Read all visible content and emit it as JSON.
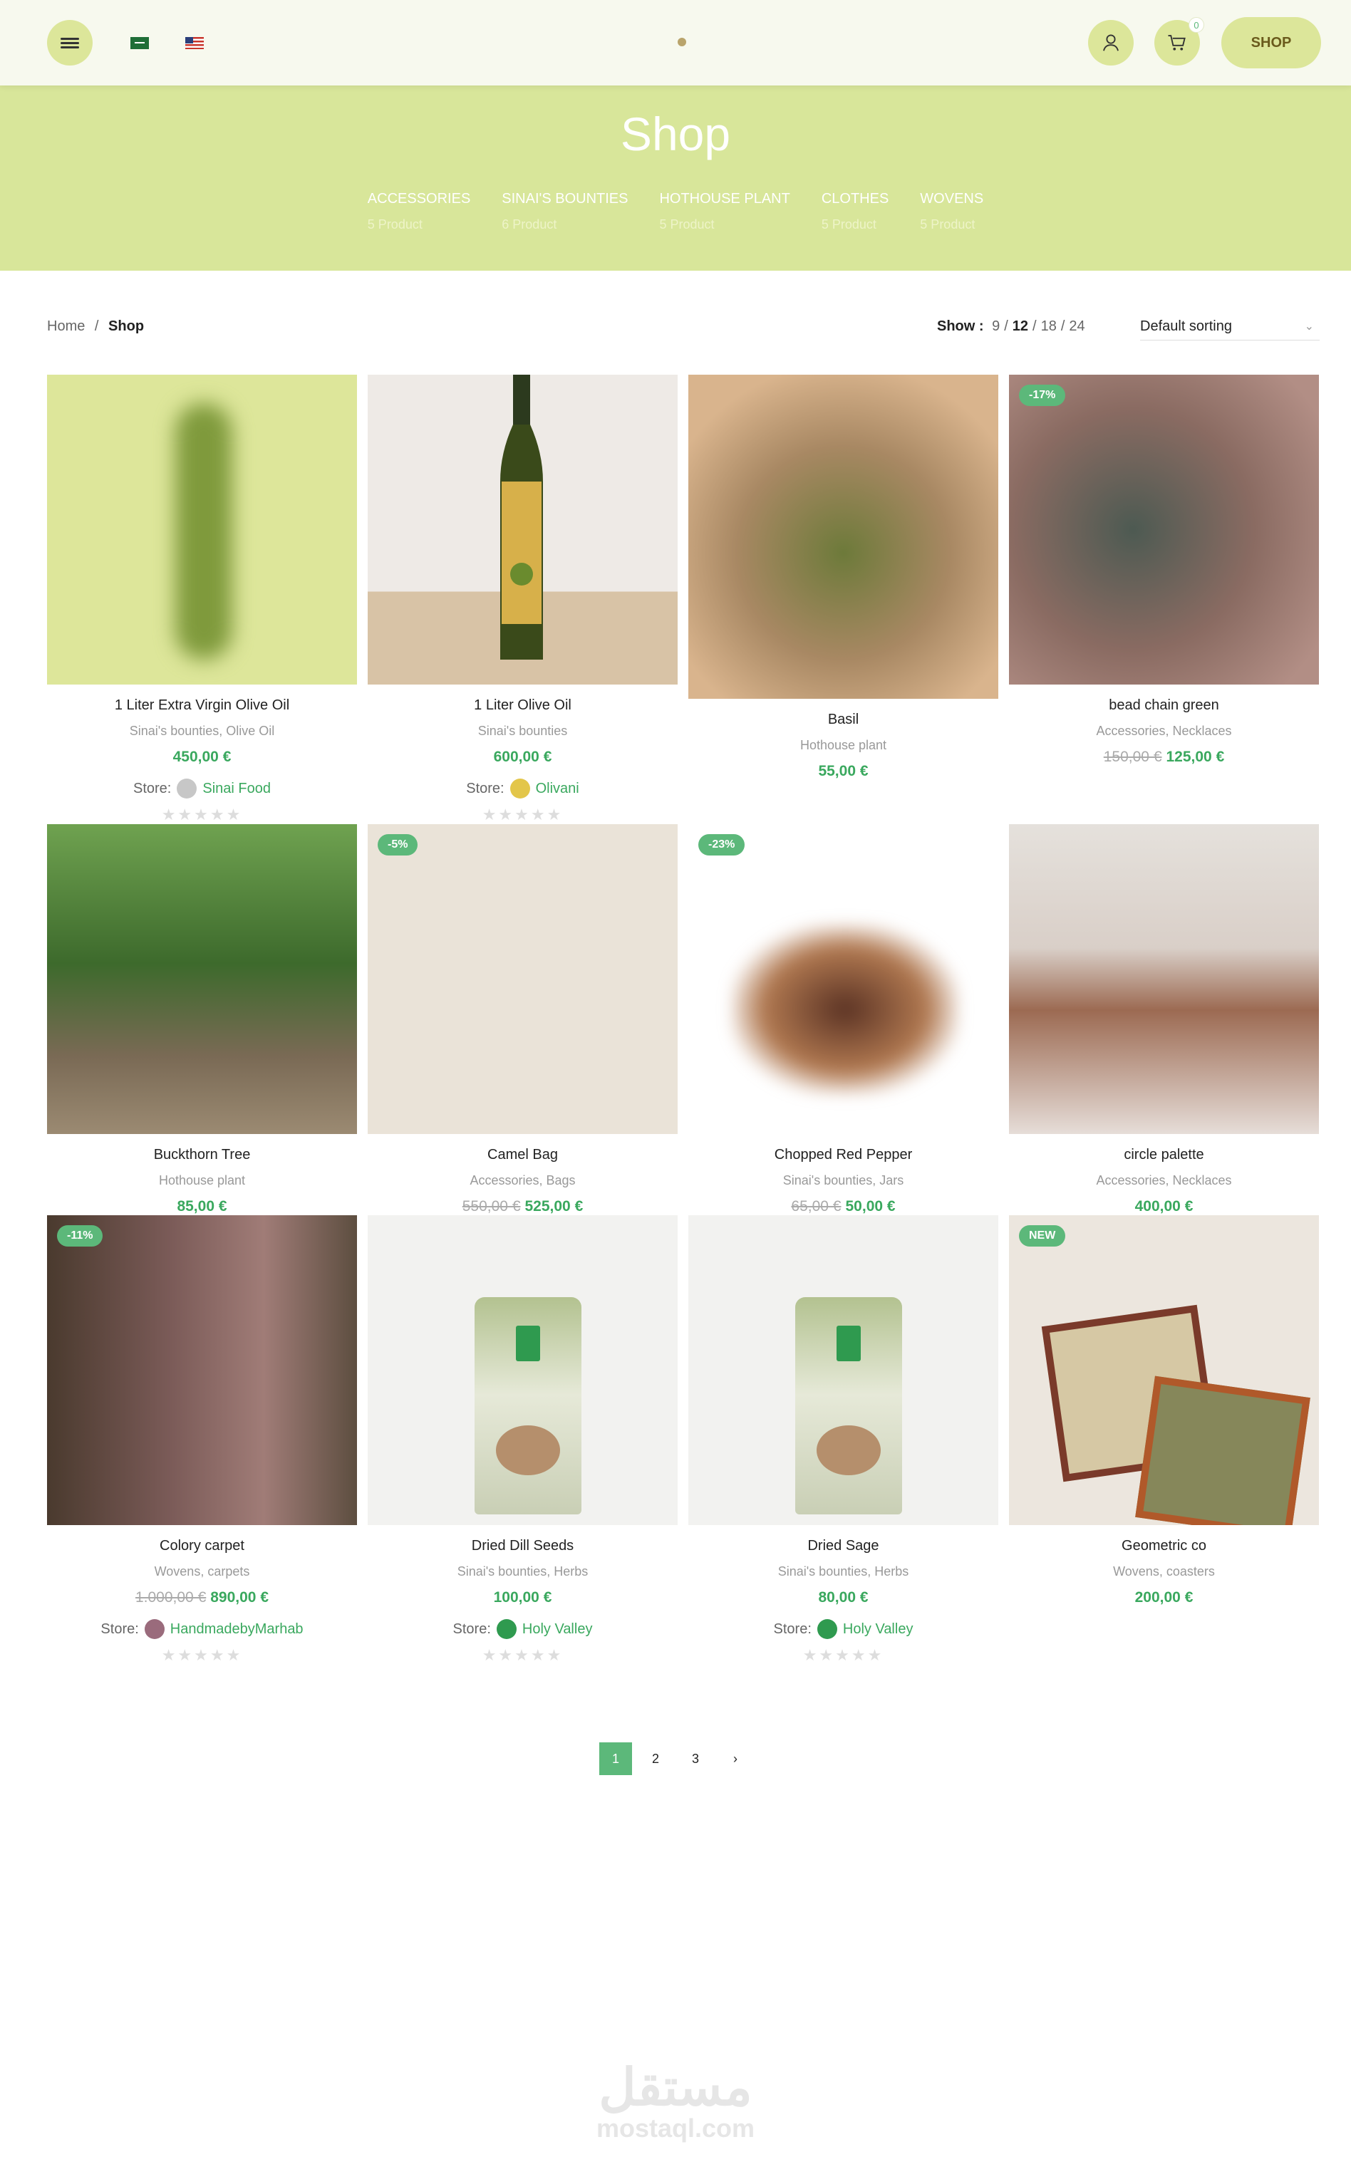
{
  "header": {
    "shop_label": "SHOP",
    "cart_count": "0"
  },
  "hero": {
    "title": "Shop",
    "categories": [
      {
        "name": "ACCESSORIES",
        "count": "5 Product"
      },
      {
        "name": "SINAI'S BOUNTIES",
        "count": "6 Product"
      },
      {
        "name": "HOTHOUSE PLANT",
        "count": "5 Product"
      },
      {
        "name": "CLOTHES",
        "count": "5 Product"
      },
      {
        "name": "WOVENS",
        "count": "5 Product"
      }
    ]
  },
  "breadcrumb": {
    "home": "Home",
    "sep": "/",
    "current": "Shop"
  },
  "toolbar": {
    "show_label": "Show :",
    "options": [
      "9",
      "12",
      "18",
      "24"
    ],
    "selected": "12",
    "sorting": "Default sorting"
  },
  "products": [
    {
      "title": "1 Liter Extra Virgin Olive Oil",
      "categories": "Sinai's bounties, Olive Oil",
      "price": "450,00 €",
      "old_price": "",
      "store_label": "Store:",
      "store": "Sinai Food",
      "badge": ""
    },
    {
      "title": "1 Liter Olive Oil",
      "categories": "Sinai's bounties",
      "price": "600,00 €",
      "old_price": "",
      "store_label": "Store:",
      "store": "Olivani",
      "badge": ""
    },
    {
      "title": "Basil",
      "categories": "Hothouse plant",
      "price": "55,00 €",
      "old_price": "",
      "store_label": "",
      "store": "",
      "badge": ""
    },
    {
      "title": "bead chain green",
      "categories": "Accessories, Necklaces",
      "price": "125,00 €",
      "old_price": "150,00 €",
      "store_label": "",
      "store": "",
      "badge": "-17%"
    },
    {
      "title": "Buckthorn Tree",
      "categories": "Hothouse plant",
      "price": "85,00 €",
      "old_price": "",
      "store_label": "",
      "store": "",
      "badge": ""
    },
    {
      "title": "Camel Bag",
      "categories": "Accessories, Bags",
      "price": "525,00 €",
      "old_price": "550,00 €",
      "store_label": "",
      "store": "",
      "badge": "-5%"
    },
    {
      "title": "Chopped Red Pepper",
      "categories": "Sinai's bounties, Jars",
      "price": "50,00 €",
      "old_price": "65,00 €",
      "store_label": "",
      "store": "",
      "badge": "-23%"
    },
    {
      "title": "circle palette",
      "categories": "Accessories, Necklaces",
      "price": "400,00 €",
      "old_price": "",
      "store_label": "",
      "store": "",
      "badge": ""
    },
    {
      "title": "Colory carpet",
      "categories": "Wovens, carpets",
      "price": "890,00 €",
      "old_price": "1.000,00 €",
      "store_label": "Store:",
      "store": "HandmadebyMarhab",
      "badge": "-11%"
    },
    {
      "title": "Dried Dill Seeds",
      "categories": "Sinai's bounties, Herbs",
      "price": "100,00 €",
      "old_price": "",
      "store_label": "Store:",
      "store": "Holy Valley",
      "badge": ""
    },
    {
      "title": "Dried Sage",
      "categories": "Sinai's bounties, Herbs",
      "price": "80,00 €",
      "old_price": "",
      "store_label": "Store:",
      "store": "Holy Valley",
      "badge": ""
    },
    {
      "title": "Geometric co",
      "categories": "Wovens, coasters",
      "price": "200,00 €",
      "old_price": "",
      "store_label": "",
      "store": "",
      "badge": "NEW"
    }
  ],
  "pagination": {
    "pages": [
      "1",
      "2",
      "3"
    ],
    "current": "1",
    "next": "›"
  },
  "watermark": {
    "arabic": "مستقل",
    "latin": "mostaql.com"
  },
  "colors": {
    "accent": "#5cb87a",
    "hero_bg": "#d8e69a",
    "button_bg": "#dce69a"
  }
}
